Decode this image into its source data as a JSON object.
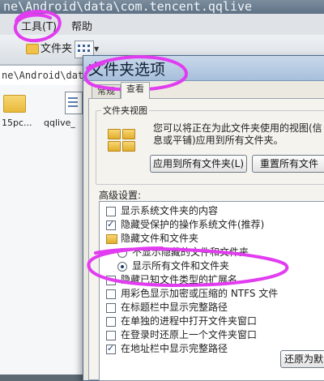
{
  "explorer": {
    "title": "ne\\Android\\data\\com.tencent.qqlive",
    "menu": {
      "tools_label": "工具(T)",
      "help_label": "帮助"
    },
    "toolbar": {
      "folder_button_label": "文件夹"
    },
    "address": "ne\\Android\\data",
    "files": [
      {
        "name": "15pc..."
      },
      {
        "name": "qqlive_"
      }
    ]
  },
  "dialog": {
    "title": "文件夹选项",
    "tabs": [
      {
        "label": "常规"
      },
      {
        "label": "查看"
      }
    ],
    "folder_views_group": {
      "label": "文件夹视图",
      "description": "您可以将正在为此文件夹使用的视图(信息或平铺)应用到所有文件夹。",
      "apply_button_label": "应用到所有文件夹(L)",
      "reset_button_label": "重置所有文件"
    },
    "advanced_label": "高级设置:",
    "advanced_items": [
      {
        "kind": "checkbox",
        "label": "显示系统文件夹的内容",
        "checked": false
      },
      {
        "kind": "checkbox",
        "label": "隐藏受保护的操作系统文件(推荐)",
        "checked": true
      },
      {
        "kind": "folder",
        "label": "隐藏文件和文件夹"
      },
      {
        "kind": "radio",
        "label": "不显示隐藏的文件和文件夹",
        "checked": false
      },
      {
        "kind": "radio",
        "label": "显示所有文件和文件夹",
        "checked": true
      },
      {
        "kind": "checkbox",
        "label": "隐藏已知文件类型的扩展名",
        "checked": false
      },
      {
        "kind": "checkbox",
        "label": "用彩色显示加密或压缩的 NTFS 文件",
        "checked": false
      },
      {
        "kind": "checkbox",
        "label": "在标题栏中显示完整路径",
        "checked": false
      },
      {
        "kind": "checkbox",
        "label": "在单独的进程中打开文件夹窗口",
        "checked": false
      },
      {
        "kind": "checkbox",
        "label": "在登录时还原上一个文件夹窗口",
        "checked": false
      },
      {
        "kind": "checkbox",
        "label": "在地址栏中显示完整路径",
        "checked": true
      }
    ],
    "restore_button_label": "还原为默"
  },
  "annotation_color": "#e23cf0"
}
